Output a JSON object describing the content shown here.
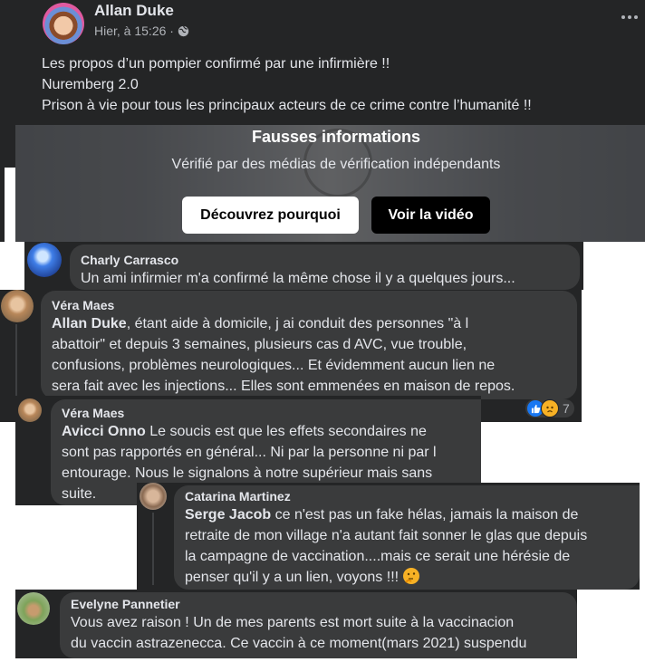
{
  "post": {
    "author": "Allan Duke",
    "time": "Hier, à 15:26",
    "sep": "·",
    "lines": [
      "Les propos d’un pompier confirmé par une infirmière !!",
      "Nuremberg 2.0",
      "Prison à vie pour tous les principaux acteurs de ce crime contre l’humanité !!"
    ],
    "more_icon": "more-dots-icon",
    "privacy_icon": "globe-icon"
  },
  "false_info": {
    "title": "Fausses informations",
    "subtitle": "Vérifié par des médias de vérification indépendants",
    "learn_button": "Découvrez pourquoi",
    "video_button": "Voir la vidéo"
  },
  "comments": [
    {
      "author": "Charly Carrasco",
      "text": "Un ami infirmier m'a confirmé la même chose il y a quelques jours..."
    },
    {
      "author": "Véra Maes",
      "mention": "Allan Duke",
      "lines": [
        ", étant aide à domicile, j ai conduit des personnes \"à l",
        "abattoir\" et depuis 3 semaines, plusieurs cas d AVC, vue trouble,",
        "confusions, problèmes neurologiques... Et évidemment aucun lien ne",
        "sera fait avec les injections... Elles sont emmenées en maison de repos."
      ],
      "reaction_count": "7"
    },
    {
      "author": "Véra Maes",
      "mention": "Avicci Onno",
      "lines": [
        " Le soucis est que les effets secondaires ne",
        "sont pas rapportés en général... Ni par la personne ni par l",
        "entourage. Nous le signalons à notre supérieur mais sans",
        "suite."
      ]
    },
    {
      "author": "Catarina Martinez",
      "mention": "Serge Jacob",
      "lines": [
        " ce n'est pas un fake hélas, jamais la maison de",
        "retraite de mon village n'a autant fait sonner le glas que depuis",
        "la campagne de vaccination....mais ce serait une hérésie de",
        "penser qu'il y a un lien, voyons !!! "
      ]
    },
    {
      "author": "Evelyne Pannetier",
      "lines": [
        "Vous avez raison ! Un de mes parents est mort suite à la vaccinacion",
        "du vaccin astrazenecca. Ce vaccin à ce moment(mars 2021) suspendu"
      ]
    }
  ],
  "colors": {
    "panel": "#242526",
    "bubble": "#3a3b3c",
    "text": "#e4e6eb",
    "secondary": "#b0b3b8",
    "like": "#1877f2"
  }
}
